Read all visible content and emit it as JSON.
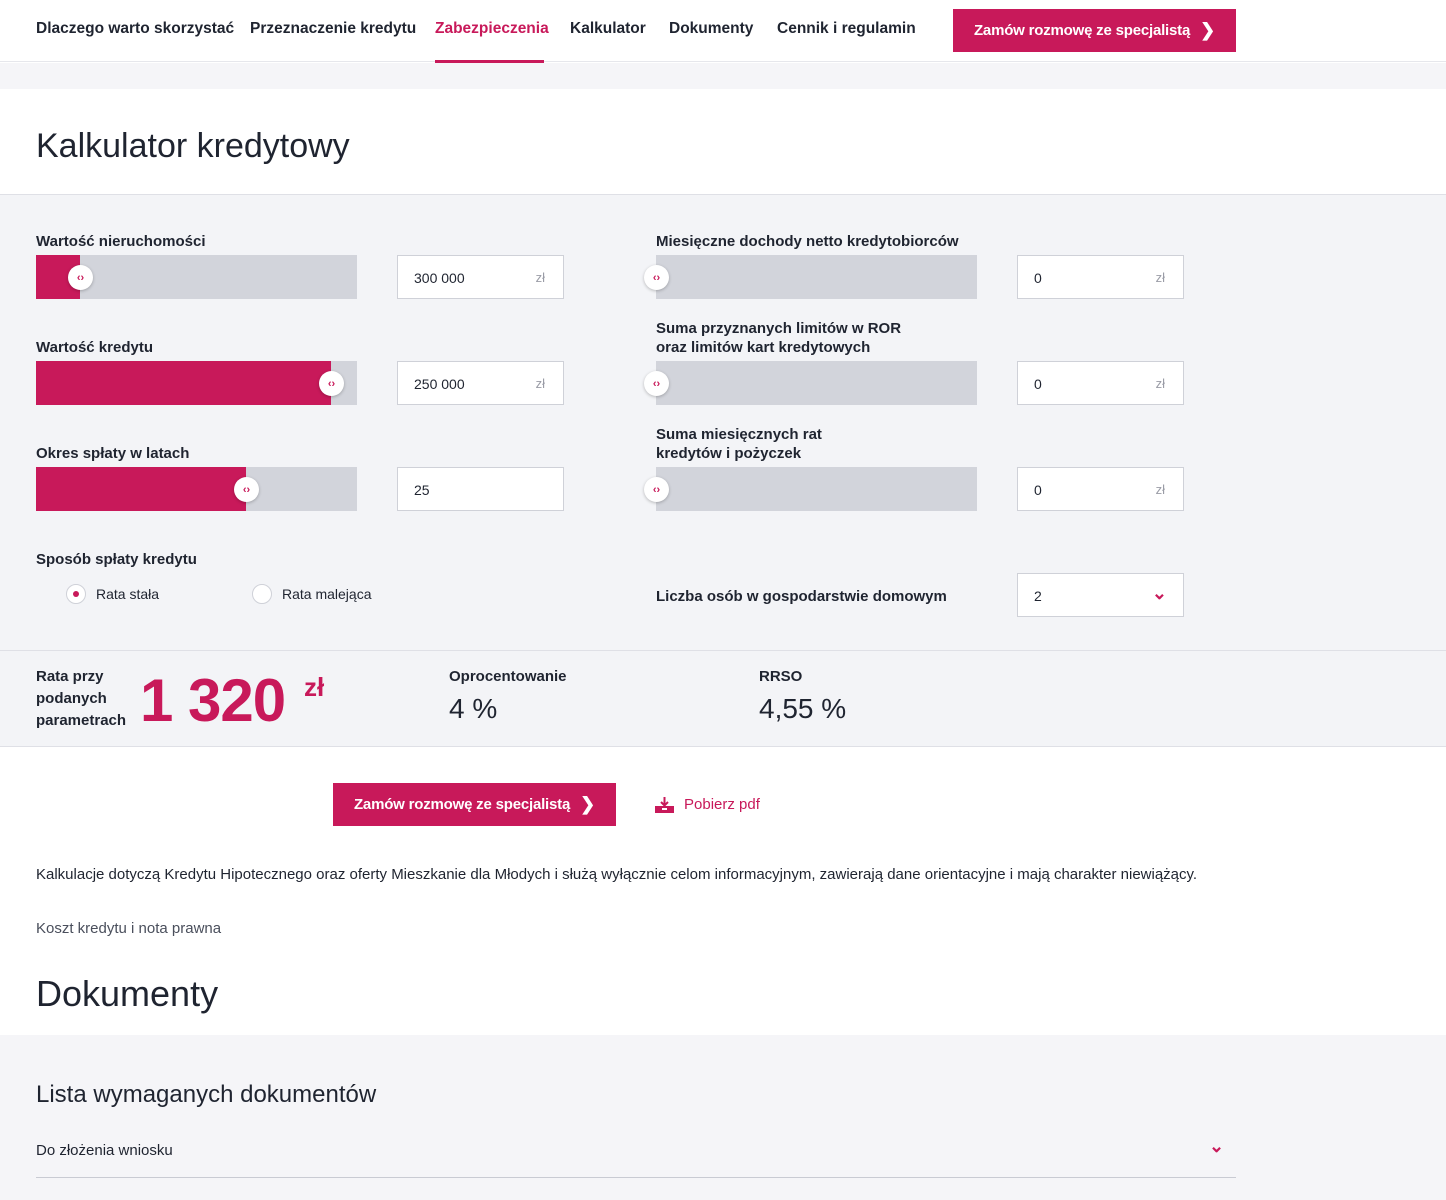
{
  "nav": {
    "items": [
      {
        "label": "Dlaczego warto skorzystać"
      },
      {
        "label": "Przeznaczenie kredytu"
      },
      {
        "label": "Zabezpieczenia",
        "active": true
      },
      {
        "label": "Kalkulator"
      },
      {
        "label": "Dokumenty"
      },
      {
        "label": "Cennik i regulamin"
      }
    ],
    "cta_label": "Zamów rozmowę ze specjalistą"
  },
  "calculator": {
    "title": "Kalkulator kredytowy",
    "left": {
      "property_value": {
        "label": "Wartość nieruchomości",
        "value": "300 000",
        "unit": "zł",
        "level": 0.14
      },
      "loan_value": {
        "label": "Wartość kredytu",
        "value": "250 000",
        "unit": "zł",
        "level": 0.92
      },
      "period": {
        "label": "Okres spłaty w latach",
        "value": "25",
        "level": 0.655
      },
      "repayment": {
        "label": "Sposób spłaty kredytu",
        "options": [
          {
            "label": "Rata stała",
            "selected": true
          },
          {
            "label": "Rata malejąca",
            "selected": false
          }
        ]
      }
    },
    "right": {
      "income": {
        "label": "Miesięczne dochody netto kredytobiorców",
        "value": "0",
        "unit": "zł",
        "level": 0
      },
      "limits": {
        "label_line1": "Suma przyznanych limitów w ROR",
        "label_line2": "oraz limitów kart kredytowych",
        "value": "0",
        "unit": "zł",
        "level": 0
      },
      "installments": {
        "label_line1": "Suma miesięcznych rat",
        "label_line2": "kredytów i pożyczek",
        "value": "0",
        "unit": "zł",
        "level": 0
      },
      "household": {
        "label": "Liczba osób w gospodarstwie domowym",
        "value": "2"
      }
    }
  },
  "results": {
    "rate_label_line1": "Rata przy",
    "rate_label_line2": "podanych",
    "rate_label_line3": "parametrach",
    "rate_value": "1 320",
    "rate_unit": "zł",
    "interest_label": "Oprocentowanie",
    "interest_value": "4 %",
    "rrso_label": "RRSO",
    "rrso_value": "4,55 %"
  },
  "actions": {
    "cta_label": "Zamów rozmowę ze specjalistą",
    "pdf_label": "Pobierz pdf"
  },
  "disclaimer": "Kalkulacje dotyczą Kredytu Hipotecznego oraz oferty Mieszkanie dla Młodych i służą wyłącznie celom informacyjnym, zawierają dane orientacyjne i mają charakter niewiążący.",
  "cost_note_link": "Koszt kredytu i nota prawna",
  "documents": {
    "title": "Dokumenty",
    "list_title": "Lista wymaganych dokumentów",
    "accordion": [
      {
        "label": "Do złożenia wniosku",
        "expanded": false
      }
    ]
  },
  "colors": {
    "accent": "#c8195a",
    "track": "#d2d4db",
    "panel": "#f3f4f7"
  }
}
